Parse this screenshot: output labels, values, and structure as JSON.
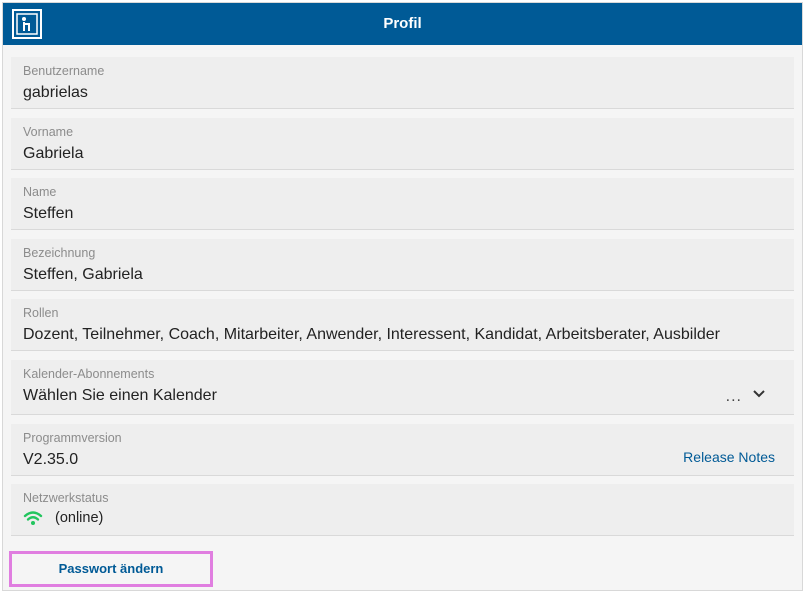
{
  "header": {
    "title": "Profil",
    "logo_icon": "logo-icon"
  },
  "fields": {
    "username": {
      "label": "Benutzername",
      "value": "gabrielas"
    },
    "firstname": {
      "label": "Vorname",
      "value": "Gabriela"
    },
    "lastname": {
      "label": "Name",
      "value": "Steffen"
    },
    "designation": {
      "label": "Bezeichnung",
      "value": "Steffen, Gabriela"
    },
    "roles": {
      "label": "Rollen",
      "value": "Dozent, Teilnehmer, Coach, Mitarbeiter, Anwender, Interessent, Kandidat, Arbeitsberater, Ausbilder"
    },
    "calendar": {
      "label": "Kalender-Abonnements",
      "placeholder": "Wählen Sie einen Kalender",
      "more": "...",
      "icon": "chevron-down-icon"
    },
    "version": {
      "label": "Programmversion",
      "value": "V2.35.0",
      "link": "Release Notes"
    },
    "network": {
      "label": "Netzwerkstatus",
      "value": "(online)",
      "icon": "wifi-icon",
      "icon_color": "#22c55e"
    }
  },
  "actions": {
    "change_password": "Passwort ändern"
  },
  "colors": {
    "header_bg": "#005a96",
    "link": "#005a96",
    "highlight_border": "#e07ee0"
  }
}
